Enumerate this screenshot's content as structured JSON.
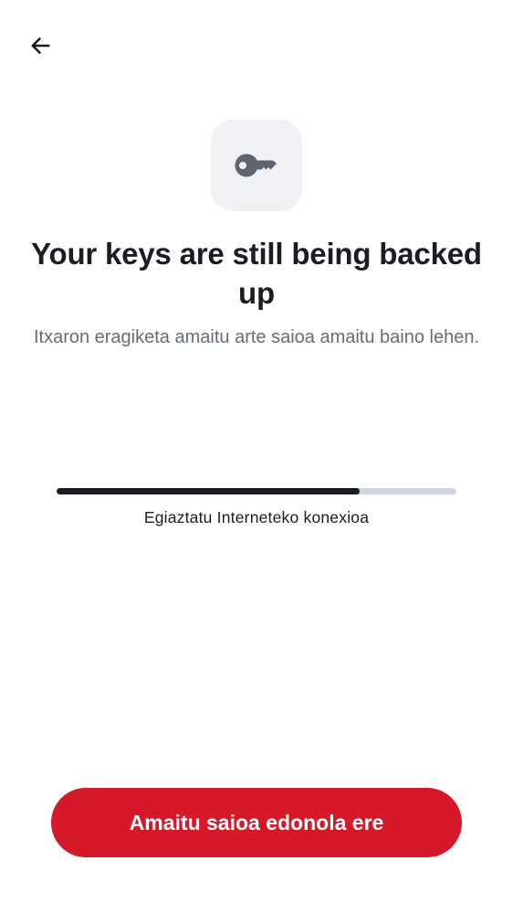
{
  "header": {
    "back_icon": "arrow-left-icon"
  },
  "hero": {
    "icon": "key-icon",
    "title": "Your keys are still being backed up",
    "subtitle": "Itxaron eragiketa amaitu arte saioa amaitu baino lehen."
  },
  "progress": {
    "fraction": 0.758,
    "label": "Egiaztatu Interneteko konexioa"
  },
  "actions": {
    "signout_label": "Amaitu saioa edonola ere"
  },
  "colors": {
    "accent": "#d51928",
    "text_primary": "#1b1d22",
    "text_secondary": "#656d77",
    "icon_tile": "#eff1f5",
    "icon_fill": "#5e6570",
    "progress_track": "#cfd5dd",
    "progress_fill": "#1b1d22"
  }
}
